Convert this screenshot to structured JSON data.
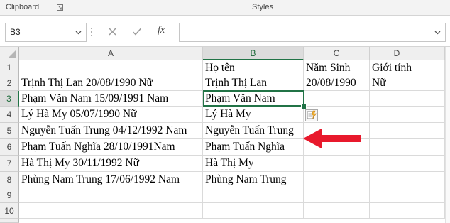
{
  "ribbon": {
    "clipboard_label": "Clipboard",
    "styles_label": "Styles"
  },
  "formula_bar": {
    "name_box": "B3",
    "fx_label": "fx",
    "formula": ""
  },
  "columns": [
    "A",
    "B",
    "C",
    "D"
  ],
  "rows": [
    "1",
    "2",
    "3",
    "4",
    "5",
    "6",
    "7",
    "8",
    "9",
    "10"
  ],
  "cells": {
    "B1": "Họ tên",
    "C1": "Năm Sinh",
    "D1": "Giới tính",
    "A2": "Trịnh Thị Lan 20/08/1990 Nữ",
    "B2": "Trịnh Thị Lan",
    "C2": "20/08/1990",
    "D2": "Nữ",
    "A3": "Phạm Văn Nam 15/09/1991 Nam",
    "B3": "Phạm Văn Nam",
    "A4": "Lý Hà My 05/07/1990 Nữ",
    "B4": "Lý Hà My",
    "A5": "Nguyễn Tuấn Trung 04/12/1992 Nam",
    "B5": "Nguyễn Tuấn Trung",
    "A6": "Phạm Tuấn Nghĩa 28/10/1991Nam",
    "B6": "Phạm Tuấn Nghĩa",
    "A7": "Hà Thị My 30/11/1992 Nữ",
    "B7": "Hà Thị My",
    "A8": "Phùng Nam Trung 17/06/1992 Nam",
    "B8": "Phùng Nam Trung"
  },
  "selected_cell": "B3",
  "colors": {
    "accent": "#217346",
    "arrow": "#e8192c"
  },
  "icons": {
    "cancel": "close-icon",
    "enter": "check-icon",
    "insert_function": "fx-icon",
    "flash_fill_options": "flash-fill-icon",
    "annotation_arrow": "red-arrow-icon"
  }
}
